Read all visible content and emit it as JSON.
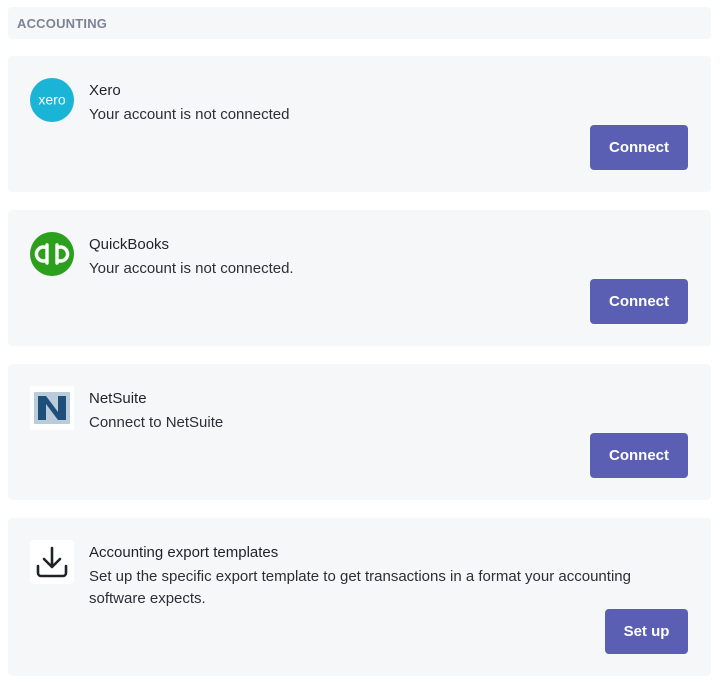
{
  "section": {
    "title": "ACCOUNTING"
  },
  "integrations": [
    {
      "name": "Xero",
      "description": "Your account is not connected",
      "action_label": "Connect",
      "logo_icon": "xero-logo-icon",
      "logo_text": "xero",
      "logo_color": "#1ab4d7"
    },
    {
      "name": "QuickBooks",
      "description": "Your account is not connected.",
      "action_label": "Connect",
      "logo_icon": "quickbooks-logo-icon",
      "logo_text": "qb",
      "logo_color": "#2ca01c"
    },
    {
      "name": "NetSuite",
      "description": "Connect to NetSuite",
      "action_label": "Connect",
      "logo_icon": "netsuite-logo-icon",
      "logo_text": "N",
      "logo_color": "#1d4f7a"
    },
    {
      "name": "Accounting export templates",
      "description": "Set up the specific export template to get transactions in a format your accounting software expects.",
      "action_label": "Set up",
      "logo_icon": "download-icon"
    }
  ],
  "colors": {
    "card_background": "#f6f7f9",
    "button": "#5a5fb3",
    "header_text": "#7b8394"
  }
}
